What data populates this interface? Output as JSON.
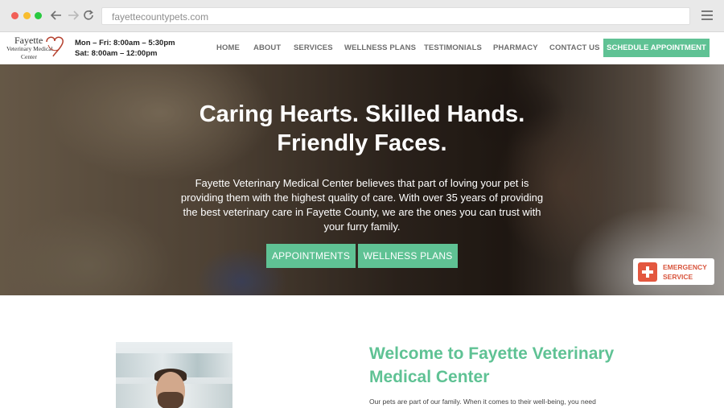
{
  "browser": {
    "url": "fayettecountypets.com"
  },
  "logo": {
    "line1": "Fayette",
    "line2": "Veterinary Medical",
    "line3": "Center"
  },
  "hours": {
    "weekday": "Mon – Fri: 8:00am – 5:30pm",
    "saturday": "Sat: 8:00am – 12:00pm"
  },
  "nav": {
    "items": [
      "HOME",
      "ABOUT",
      "SERVICES",
      "WELLNESS PLANS",
      "TESTIMONIALS",
      "PHARMACY",
      "CONTACT US"
    ],
    "schedule_label": "SCHEDULE APPOINTMENT"
  },
  "hero": {
    "title_line1": "Caring Hearts. Skilled Hands.",
    "title_line2": "Friendly Faces.",
    "text": "Fayette Veterinary Medical Center believes that part of loving your pet is providing them with the highest quality of care. With over 35 years of providing the best veterinary care in Fayette County, we are the ones you can trust with your furry family.",
    "btn_appointments": "APPOINTMENTS",
    "btn_wellness": "WELLNESS PLANS"
  },
  "emergency": {
    "line1": "EMERGENCY",
    "line2": "SERVICE"
  },
  "welcome": {
    "title": "Welcome to Fayette Veterinary Medical Center",
    "text": "Our pets are part of our family. When it comes to their well-being, you need"
  },
  "colors": {
    "accent": "#5fc294",
    "emergency": "#e3573f"
  }
}
